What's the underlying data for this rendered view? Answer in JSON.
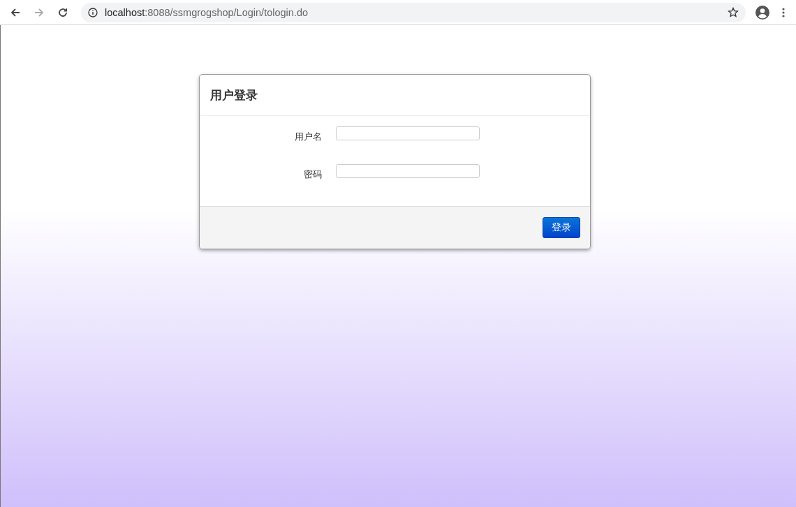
{
  "browser": {
    "url_host": "localhost",
    "url_path": ":8088/ssmgrogshop/Login/tologin.do",
    "back_disabled": false,
    "forward_disabled": true
  },
  "dialog": {
    "title": "用户登录",
    "fields": [
      {
        "label": "用户名"
      },
      {
        "label": "密码"
      }
    ],
    "buttons": [
      "登录"
    ]
  }
}
